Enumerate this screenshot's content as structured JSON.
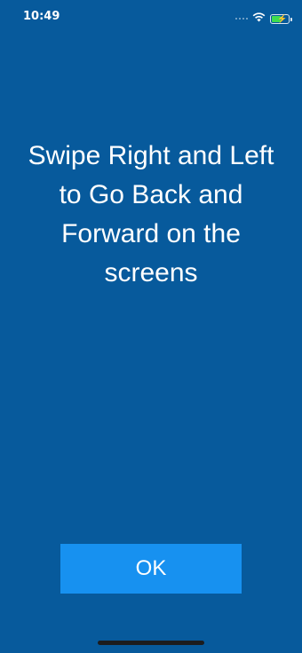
{
  "status_bar": {
    "time": "10:49",
    "icons": [
      "cellular-signal-icon",
      "wifi-icon",
      "battery-charging-icon"
    ]
  },
  "main": {
    "message": "Swipe Right and Left to Go Back and Forward on the screens"
  },
  "actions": {
    "ok_label": "OK"
  },
  "colors": {
    "background": "#075A9C",
    "button": "#1791F0",
    "text": "#FFFFFF"
  }
}
